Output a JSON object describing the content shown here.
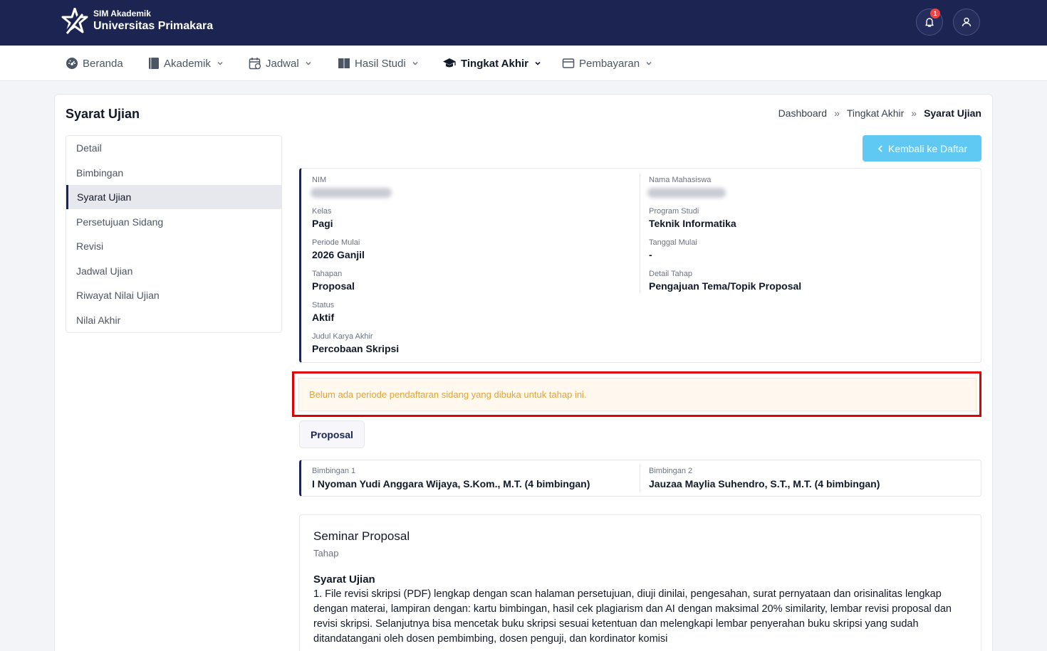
{
  "brand": {
    "subtitle": "SIM Akademik",
    "title": "Universitas Primakara"
  },
  "header": {
    "notification_count": "1"
  },
  "nav": [
    {
      "label": "Beranda",
      "icon": "dashboard-icon"
    },
    {
      "label": "Akademik",
      "icon": "book-icon"
    },
    {
      "label": "Jadwal",
      "icon": "calendar-icon"
    },
    {
      "label": "Hasil Studi",
      "icon": "open-book-icon"
    },
    {
      "label": "Tingkat Akhir",
      "icon": "graduation-cap-icon",
      "active": true
    },
    {
      "label": "Pembayaran",
      "icon": "wallet-icon"
    }
  ],
  "page": {
    "title": "Syarat Ujian"
  },
  "breadcrumb": {
    "items": [
      "Dashboard",
      "Tingkat Akhir"
    ],
    "current": "Syarat Ujian",
    "separator": "»"
  },
  "sidebar": {
    "items": [
      "Detail",
      "Bimbingan",
      "Syarat Ujian",
      "Persetujuan Sidang",
      "Revisi",
      "Jadwal Ujian",
      "Riwayat Nilai Ujian",
      "Nilai Akhir"
    ],
    "active": "Syarat Ujian"
  },
  "back_button": {
    "label": "Kembali ke Daftar"
  },
  "info": {
    "nim_label": "NIM",
    "nama_label": "Nama Mahasiswa",
    "kelas_label": "Kelas",
    "kelas_value": "Pagi",
    "prodi_label": "Program Studi",
    "prodi_value": "Teknik Informatika",
    "periode_label": "Periode Mulai",
    "periode_value": "2026 Ganjil",
    "tanggal_label": "Tanggal Mulai",
    "tanggal_value": "-",
    "tahapan_label": "Tahapan",
    "tahapan_value": "Proposal",
    "detail_label": "Detail Tahap",
    "detail_value": "Pengajuan Tema/Topik Proposal",
    "status_label": "Status",
    "status_value": "Aktif",
    "judul_label": "Judul Karya Akhir",
    "judul_value": "Percobaan Skripsi"
  },
  "alert": {
    "message": "Belum ada periode pendaftaran sidang yang dibuka untuk tahap ini."
  },
  "tab": {
    "label": "Proposal"
  },
  "advisors": {
    "b1_label": "Bimbingan 1",
    "b1_value": "I Nyoman Yudi Anggara Wijaya, S.Kom., M.T. (4 bimbingan)",
    "b2_label": "Bimbingan 2",
    "b2_value": "Jauzaa Maylia Suhendro, S.T., M.T. (4 bimbingan)"
  },
  "seminar": {
    "title": "Seminar Proposal",
    "subtitle": "Tahap",
    "req_title": "Syarat Ujian",
    "req_text": "1. File revisi skripsi (PDF) lengkap dengan scan halaman persetujuan, diuji dinilai, pengesahan, surat pernyataan dan orisinalitas lengkap dengan materai, lampiran dengan: kartu bimbingan, hasil cek plagiarism dan AI dengan maksimal 20% similarity, lembar revisi proposal dan revisi skripsi. Selanjutnya bisa mencetak buku skripsi sesuai ketentuan dan melengkapi lembar penyerahan buku skripsi yang sudah ditandatangani oleh dosen pembimbing, dosen penguji, dan kordinator komisi"
  },
  "colors": {
    "navy": "#1c2452",
    "accent_button": "#5fc8f3",
    "alert_text": "#e0a43a",
    "highlight_border": "#e00000"
  }
}
